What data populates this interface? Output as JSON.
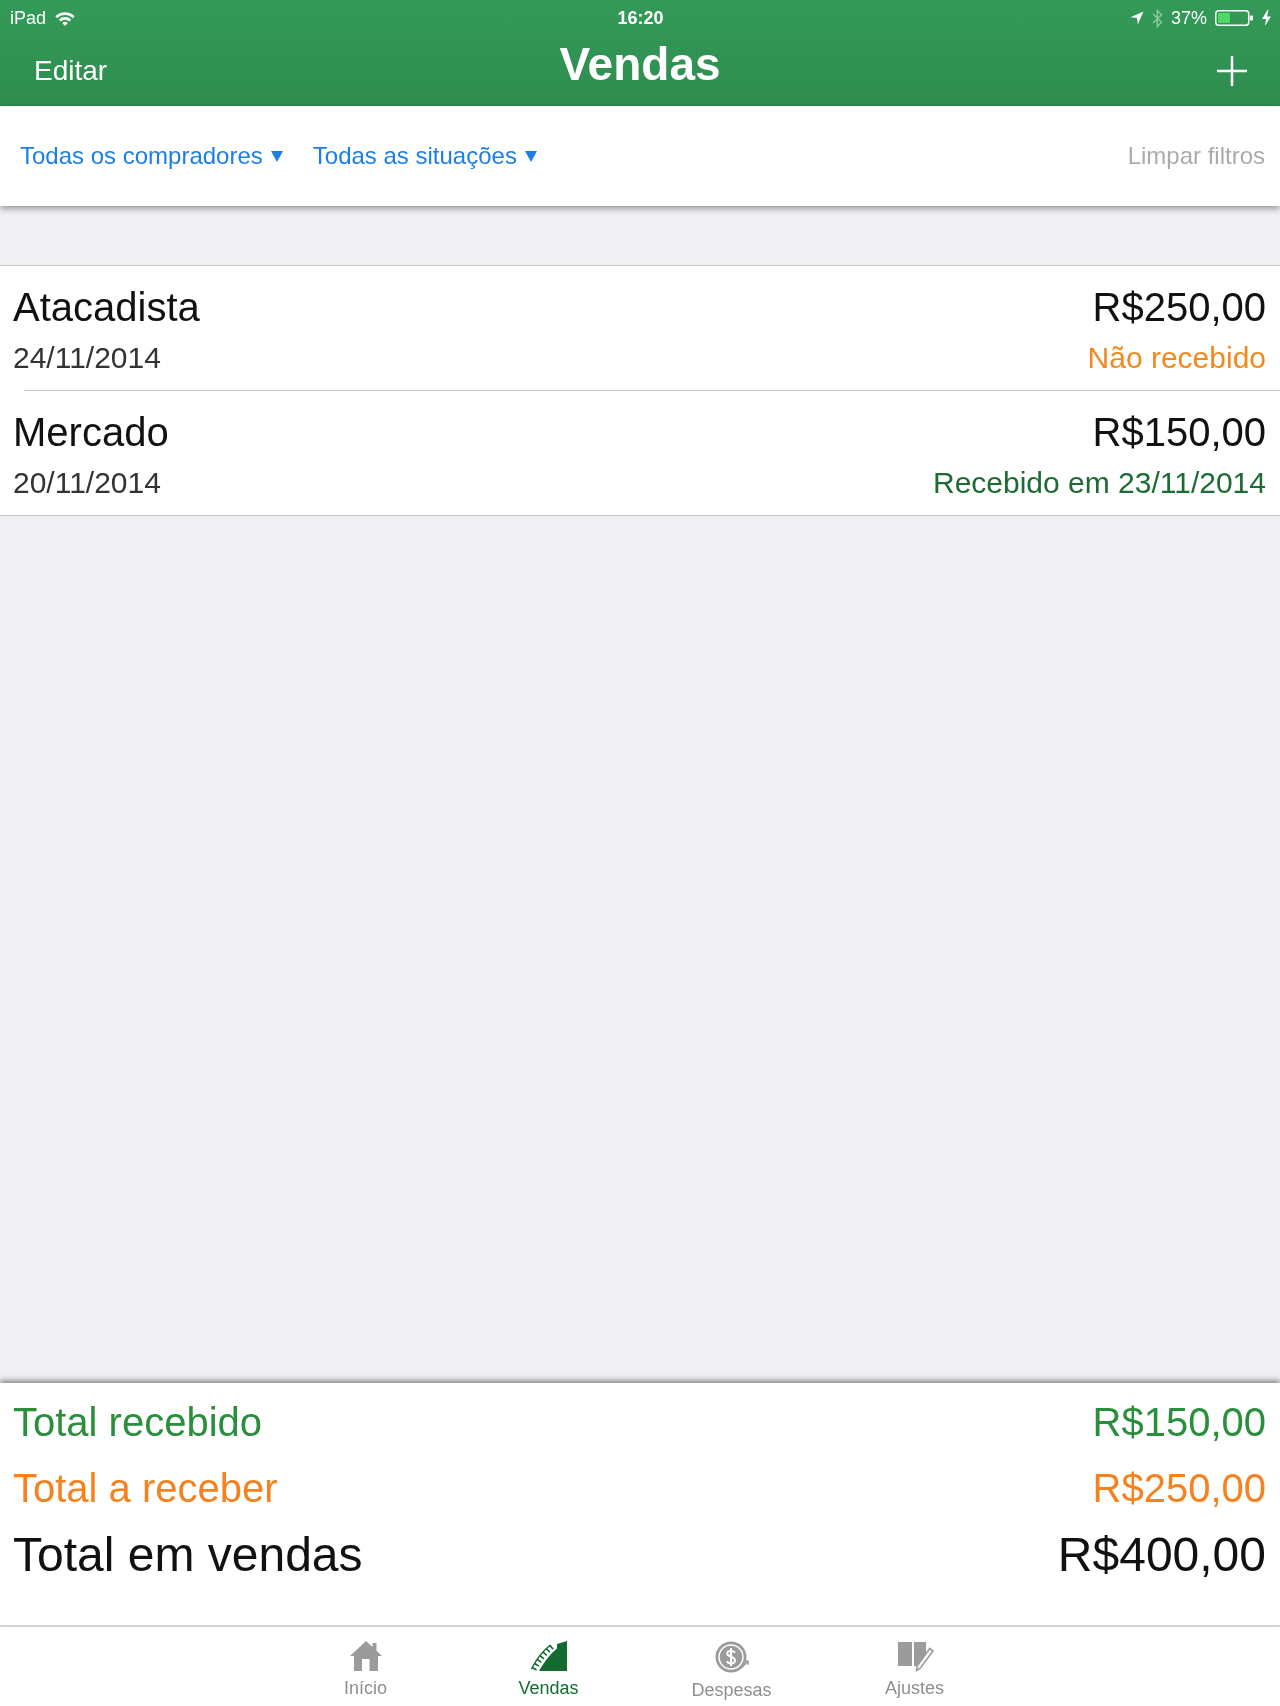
{
  "status_bar": {
    "carrier": "iPad",
    "time": "16:20",
    "battery": "37%"
  },
  "nav_bar": {
    "left_button": "Editar",
    "title": "Vendas"
  },
  "filter_bar": {
    "filters": [
      {
        "label": "Todas os compradores"
      },
      {
        "label": "Todas as situações"
      }
    ],
    "clear_button": {
      "label": "Limpar filtros",
      "disabled": true
    }
  },
  "sales": [
    {
      "name": "Atacadista",
      "date": "24/11/2014",
      "amount": "R$250,00",
      "status": "Não recebido",
      "received": false
    },
    {
      "name": "Mercado",
      "date": "20/11/2014",
      "amount": "R$150,00",
      "status": "Recebido em 23/11/2014",
      "received": true
    }
  ],
  "totals": [
    {
      "label": "Total recebido",
      "value": "R$150,00",
      "kind": "received"
    },
    {
      "label": "Total a receber",
      "value": "R$250,00",
      "kind": "pending"
    },
    {
      "label": "Total em vendas",
      "value": "R$400,00",
      "kind": "total"
    }
  ],
  "tab_bar": [
    {
      "label": "Início",
      "selected": false
    },
    {
      "label": "Vendas",
      "selected": true
    },
    {
      "label": "Despesas",
      "selected": false
    },
    {
      "label": "Ajustes",
      "selected": false
    }
  ]
}
